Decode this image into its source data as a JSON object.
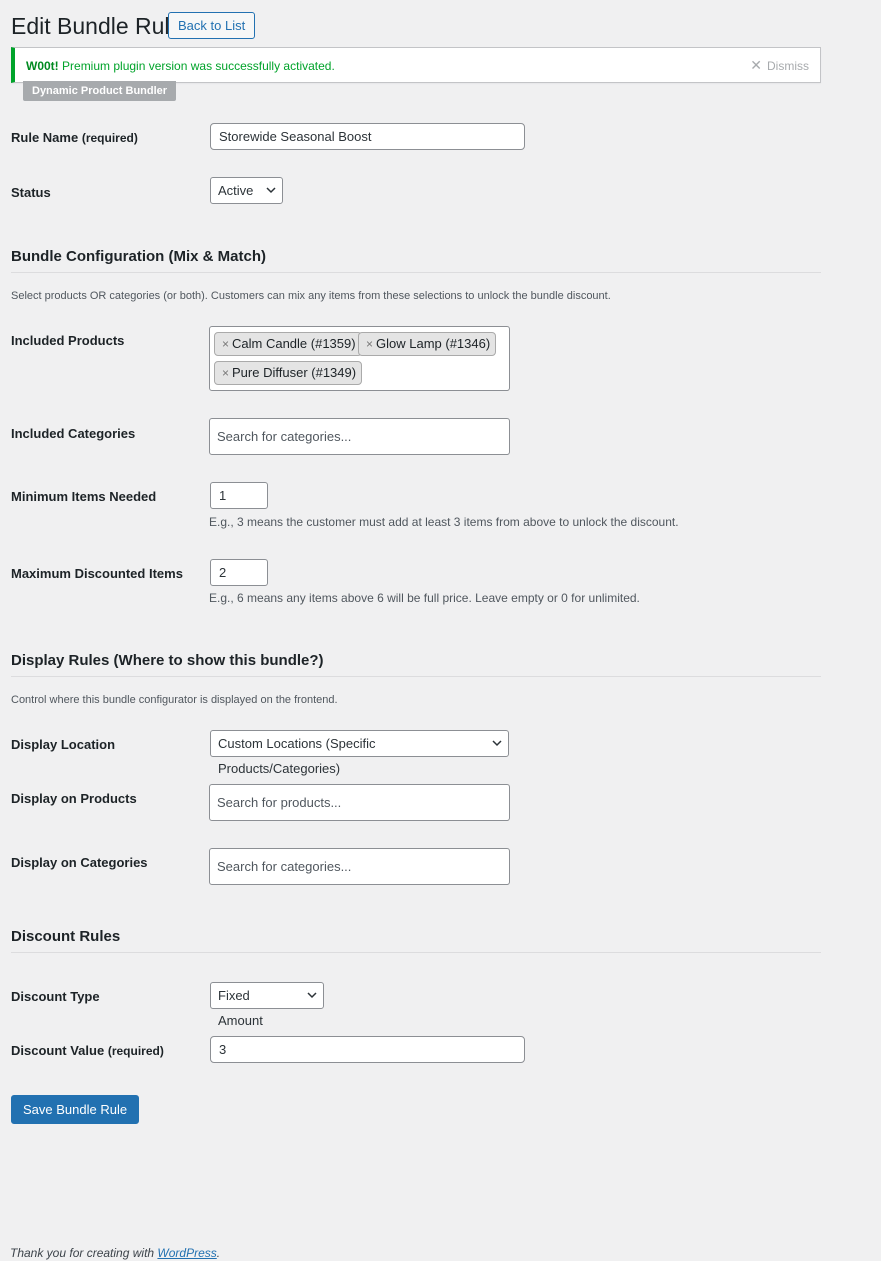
{
  "page": {
    "title": "Edit Bundle Rule",
    "back_label": "Back to List"
  },
  "notice": {
    "prefix": "W00t!",
    "message": "Premium plugin version was successfully activated.",
    "dismiss_label": "Dismiss"
  },
  "plugin_badge": "Dynamic Product Bundler",
  "rule": {
    "name_label": "Rule Name",
    "name_required": "(required)",
    "name_value": "Storewide Seasonal Boost",
    "status_label": "Status",
    "status_value": "Active"
  },
  "bundle": {
    "heading": "Bundle Configuration (Mix & Match)",
    "description": "Select products OR categories (or both). Customers can mix any items from these selections to unlock the bundle discount.",
    "products_label": "Included Products",
    "products": [
      {
        "label": "Calm Candle (#1359)"
      },
      {
        "label": "Glow Lamp (#1346)"
      },
      {
        "label": "Pure Diffuser (#1349)"
      }
    ],
    "categories_label": "Included Categories",
    "categories_placeholder": "Search for categories...",
    "min_label": "Minimum Items Needed",
    "min_value": "1",
    "min_help": "E.g., 3 means the customer must add at least 3 items from above to unlock the discount.",
    "max_label": "Maximum Discounted Items",
    "max_value": "2",
    "max_help": "E.g., 6 means any items above 6 will be full price. Leave empty or 0 for unlimited."
  },
  "display": {
    "heading": "Display Rules (Where to show this bundle?)",
    "description": "Control where this bundle configurator is displayed on the frontend.",
    "location_label": "Display Location",
    "location_value": "Custom Locations (Specific Products/Categories)",
    "products_label": "Display on Products",
    "products_placeholder": "Search for products...",
    "categories_label": "Display on Categories",
    "categories_placeholder": "Search for categories..."
  },
  "discount": {
    "heading": "Discount Rules",
    "type_label": "Discount Type",
    "type_value": "Fixed Amount",
    "value_label": "Discount Value",
    "value_required": "(required)",
    "value_value": "3"
  },
  "save_label": "Save Bundle Rule",
  "footer": {
    "text": "Thank you for creating with",
    "link": "WordPress",
    "suffix": "."
  },
  "colors": {
    "accent": "#2271b1",
    "success": "#00a32a",
    "background": "#f0f0f1"
  }
}
